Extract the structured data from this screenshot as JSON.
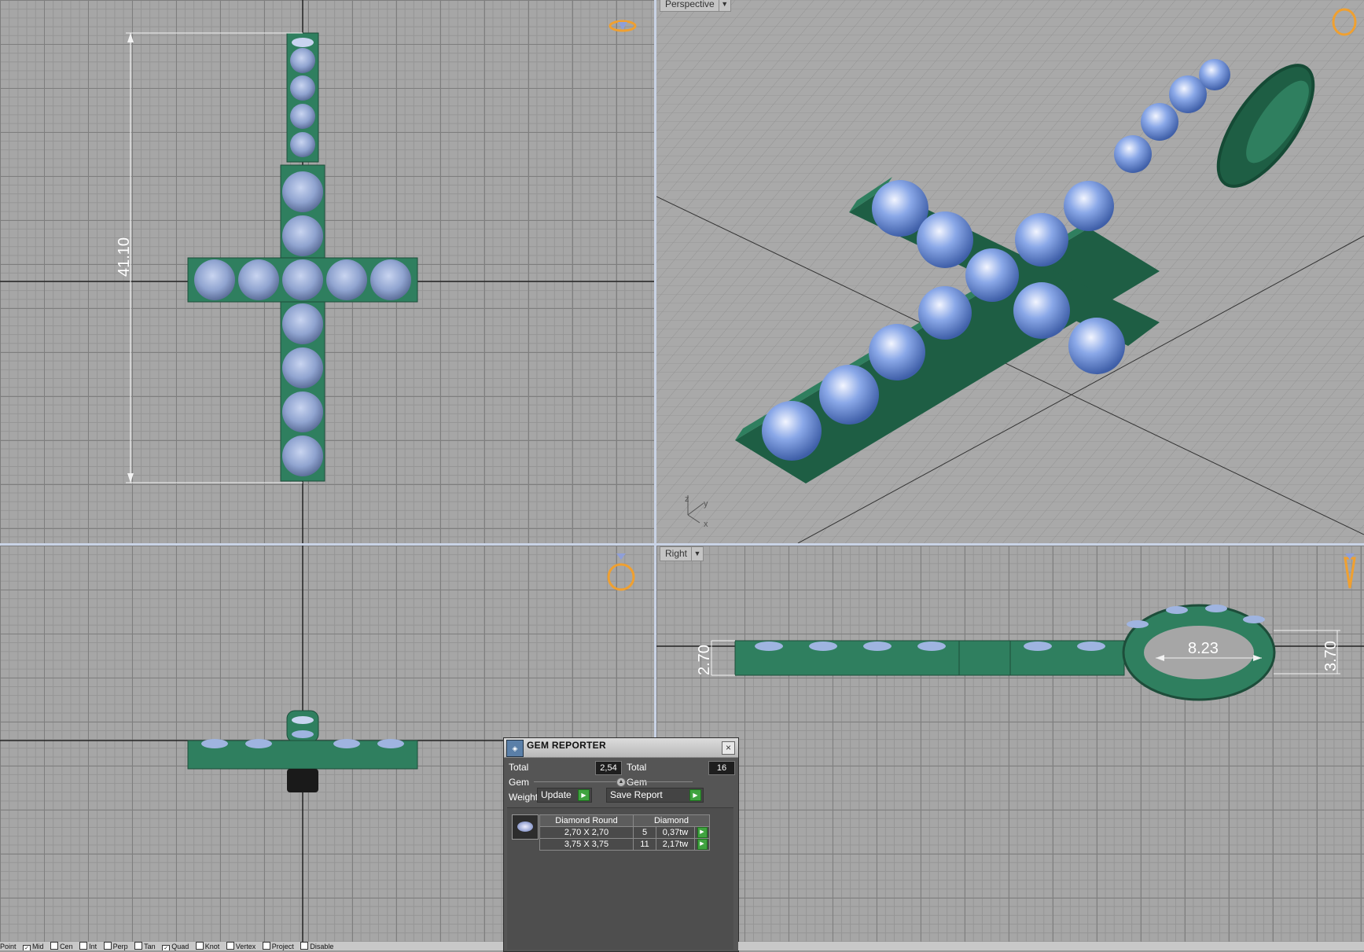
{
  "viewports": {
    "top": {
      "dimension": "41.10"
    },
    "perspective": {
      "label": "Perspective",
      "axes": {
        "z": "z",
        "y": "y",
        "x": "x"
      }
    },
    "right": {
      "label": "Right",
      "dim_left": "2.70",
      "dim_loop": "8.23",
      "dim_right": "3.70"
    }
  },
  "gem_reporter": {
    "title": "GEM REPORTER",
    "total_weight_label": "Total Gem Weight",
    "total_weight_value": "2,54",
    "total_count_label": "Total Gem Count",
    "total_count_value": "16",
    "update_label": "Update",
    "save_report_label": "Save Report",
    "table_headers": [
      "Diamond Round",
      "Diamond"
    ],
    "rows": [
      {
        "size": "2,70 X 2,70",
        "count": "5",
        "weight": "0,37tw"
      },
      {
        "size": "3,75 X 3,75",
        "count": "11",
        "weight": "2,17tw"
      }
    ]
  },
  "status_bar": {
    "options": [
      {
        "label": "Point",
        "checked": false
      },
      {
        "label": "Mid",
        "checked": true
      },
      {
        "label": "Cen",
        "checked": false
      },
      {
        "label": "Int",
        "checked": false
      },
      {
        "label": "Perp",
        "checked": false
      },
      {
        "label": "Tan",
        "checked": false
      },
      {
        "label": "Quad",
        "checked": true
      },
      {
        "label": "Knot",
        "checked": false
      },
      {
        "label": "Vertex",
        "checked": false
      },
      {
        "label": "Project",
        "checked": false
      },
      {
        "label": "Disable",
        "checked": false
      }
    ]
  },
  "colors": {
    "metal": "#2f7f5f",
    "gem": "#9fb4e0",
    "ring_icon": "#f0a030"
  }
}
